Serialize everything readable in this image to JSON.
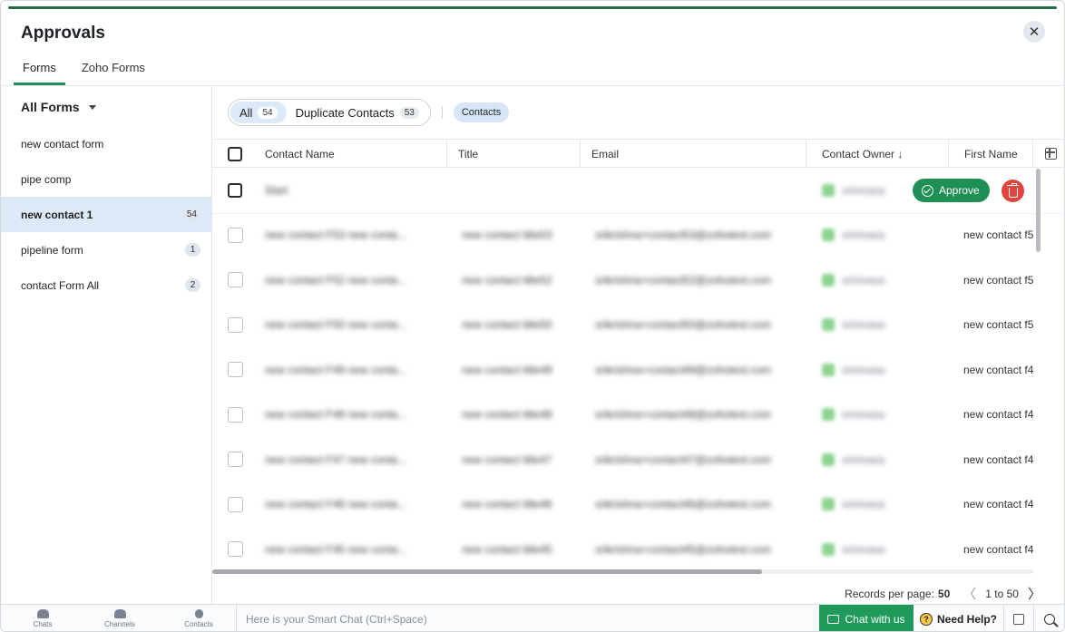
{
  "header": {
    "title": "Approvals",
    "close_glyph": "✕",
    "tabs": [
      {
        "label": "Forms",
        "active": true
      },
      {
        "label": "Zoho Forms",
        "active": false
      }
    ]
  },
  "sidebar": {
    "heading": "All Forms",
    "items": [
      {
        "label": "new contact form",
        "count": ""
      },
      {
        "label": "pipe comp",
        "count": ""
      },
      {
        "label": "new contact 1",
        "count": "54",
        "active": true
      },
      {
        "label": "pipeline form",
        "count": "1"
      },
      {
        "label": "contact Form All",
        "count": "2"
      }
    ]
  },
  "filters": {
    "all_label": "All",
    "all_count": "54",
    "dup_label": "Duplicate Contacts",
    "dup_count": "53",
    "module_chip": "Contacts"
  },
  "table": {
    "columns": {
      "name": "Contact Name",
      "title": "Title",
      "email": "Email",
      "owner": "Contact Owner ↓",
      "first_name": "First Name"
    },
    "hover_row": {
      "name": "Start",
      "approve_label": "Approve"
    },
    "rows": [
      {
        "name": "new contact F53 new conta...",
        "title": "new contact title53",
        "email": "srikrishna+contact53@zohotest.com",
        "owner": "srinivasa",
        "first_name": "new contact f5"
      },
      {
        "name": "new contact F52 new conta...",
        "title": "new contact title52",
        "email": "srikrishna+contact52@zohotest.com",
        "owner": "srinivasa",
        "first_name": "new contact f5"
      },
      {
        "name": "new contact F50 new conta...",
        "title": "new contact title50",
        "email": "srikrishna+contact50@zohotest.com",
        "owner": "srinivasa",
        "first_name": "new contact f5"
      },
      {
        "name": "new contact F49 new conta...",
        "title": "new contact title49",
        "email": "srikrishna+contact49@zohotest.com",
        "owner": "srinivasa",
        "first_name": "new contact f4"
      },
      {
        "name": "new contact F48 new conta...",
        "title": "new contact title48",
        "email": "srikrishna+contact48@zohotest.com",
        "owner": "srinivasa",
        "first_name": "new contact f4"
      },
      {
        "name": "new contact F47 new conta...",
        "title": "new contact title47",
        "email": "srikrishna+contact47@zohotest.com",
        "owner": "srinivasa",
        "first_name": "new contact f4"
      },
      {
        "name": "new contact F46 new conta...",
        "title": "new contact title46",
        "email": "srikrishna+contact46@zohotest.com",
        "owner": "srinivasa",
        "first_name": "new contact f4"
      },
      {
        "name": "new contact F45 new conta...",
        "title": "new contact title45",
        "email": "srikrishna+contact45@zohotest.com",
        "owner": "srinivasa",
        "first_name": "new contact f4"
      }
    ]
  },
  "pager": {
    "label": "Records per page:",
    "per_page": "50",
    "range": "1 to 50",
    "prev_glyph": "〈",
    "next_glyph": "〉"
  },
  "bottombar": {
    "nav": [
      {
        "label": "Chats",
        "icon": "chat-bubble-icon"
      },
      {
        "label": "Channels",
        "icon": "people-icon"
      },
      {
        "label": "Contacts",
        "icon": "person-icon"
      }
    ],
    "smartchat_placeholder": "Here is your Smart Chat (Ctrl+Space)",
    "chat_label": "Chat with us",
    "help_label": "Need Help?",
    "help_glyph": "?"
  },
  "colors": {
    "accent_green": "#1f8f55",
    "selected_bg": "#dceaf8",
    "delete_red": "#e0453d"
  }
}
